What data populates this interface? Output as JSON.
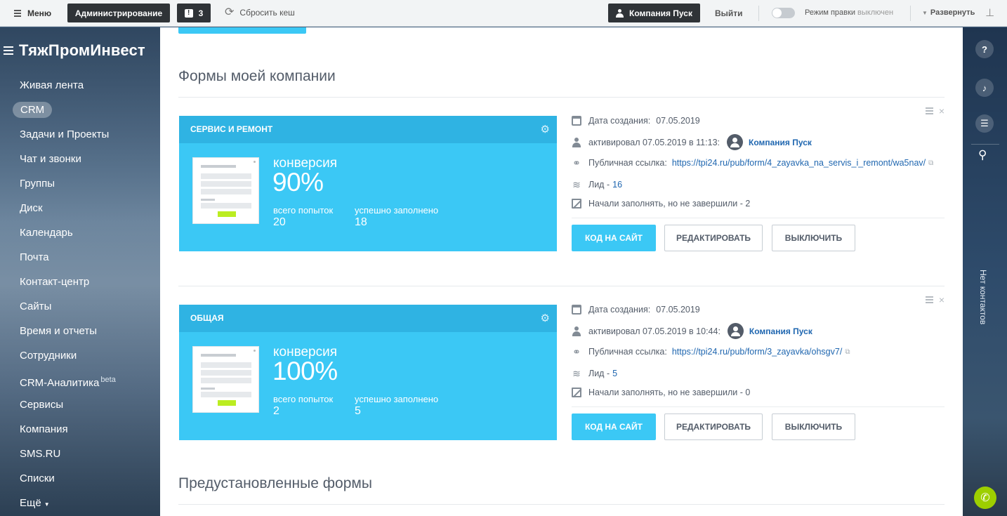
{
  "topbar": {
    "menu_label": "Меню",
    "admin_label": "Администрирование",
    "alerts_count": "3",
    "reset_cache_label": "Сбросить кеш",
    "company_label": "Компания Пуск",
    "exit_label": "Выйти",
    "edit_mode_label": "Режим правки",
    "edit_mode_state": "выключен",
    "expand_label": "Развернуть"
  },
  "sidebar": {
    "title": "ТяжПромИнвест",
    "items": [
      {
        "label": "Живая лента"
      },
      {
        "label": "CRM",
        "active": true
      },
      {
        "label": "Задачи и Проекты"
      },
      {
        "label": "Чат и звонки"
      },
      {
        "label": "Группы"
      },
      {
        "label": "Диск"
      },
      {
        "label": "Календарь"
      },
      {
        "label": "Почта"
      },
      {
        "label": "Контакт-центр"
      },
      {
        "label": "Сайты"
      },
      {
        "label": "Время и отчеты"
      },
      {
        "label": "Сотрудники"
      },
      {
        "label": "CRM-Аналитика",
        "badge": "beta"
      },
      {
        "label": "Сервисы"
      },
      {
        "label": "Компания"
      },
      {
        "label": "SMS.RU"
      },
      {
        "label": "Списки"
      },
      {
        "label": "Ещё"
      }
    ]
  },
  "main": {
    "my_forms_title": "Формы моей компании",
    "preset_forms_title": "Предустановленные формы",
    "forms": [
      {
        "name": "СЕРВИС И РЕМОНТ",
        "conversion_label": "конверсия",
        "conversion_value": "90%",
        "attempts_label": "всего попыток",
        "attempts_value": "20",
        "success_label": "успешно заполнено",
        "success_value": "18",
        "created_label": "Дата создания:",
        "created_date": "07.05.2019",
        "activated_text": "активировал 07.05.2019 в 11:13:",
        "activated_by": "Компания Пуск",
        "public_link_label": "Публичная ссылка:",
        "public_link": "https://tpi24.ru/pub/form/4_zayavka_na_servis_i_remont/wa5nav/",
        "lead_label": "Лид -",
        "lead_count": "16",
        "unfinished_text": "Начали заполнять, но не завершили - 2",
        "code_button": "КОД НА САЙТ",
        "edit_button": "РЕДАКТИРОВАТЬ",
        "disable_button": "ВЫКЛЮЧИТЬ"
      },
      {
        "name": "ОБЩАЯ",
        "conversion_label": "конверсия",
        "conversion_value": "100%",
        "attempts_label": "всего попыток",
        "attempts_value": "2",
        "success_label": "успешно заполнено",
        "success_value": "5",
        "created_label": "Дата создания:",
        "created_date": "07.05.2019",
        "activated_text": "активировал 07.05.2019 в 10:44:",
        "activated_by": "Компания Пуск",
        "public_link_label": "Публичная ссылка:",
        "public_link": "https://tpi24.ru/pub/form/3_zayavka/ohsgv7/",
        "lead_label": "Лид -",
        "lead_count": "5",
        "unfinished_text": "Начали заполнять, но не завершили - 0",
        "code_button": "КОД НА САЙТ",
        "edit_button": "РЕДАКТИРОВАТЬ",
        "disable_button": "ВЫКЛЮЧИТЬ"
      }
    ]
  },
  "rightbar": {
    "help_glyph": "?",
    "contacts_label": "Нет контактов"
  },
  "colors": {
    "accent": "#3bc8f5",
    "link": "#2067b0",
    "dark_button": "#2f3337",
    "call_button": "#9dcf00"
  },
  "icons": [
    "menu-icon",
    "alert-icon",
    "refresh-icon",
    "user-icon",
    "pin-icon",
    "gear-icon",
    "calendar-icon",
    "person-icon",
    "link-icon",
    "layers-icon",
    "partial-icon",
    "drag-icon",
    "close-icon",
    "help-icon",
    "bell-icon",
    "chat-icon",
    "search-icon",
    "phone-icon"
  ]
}
